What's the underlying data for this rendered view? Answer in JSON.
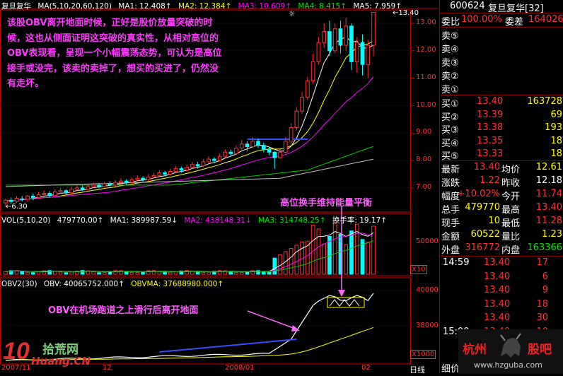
{
  "chart_header": {
    "stock_name": "复旦复华",
    "ma_label": "MA(5,10,20,60,120)",
    "ma1": "MA1: 12.408↑",
    "ma2": "MA2: 12.384↑",
    "ma3": "MA3: 10.609↑",
    "ma4": "MA4: 8.415↑",
    "ma5": "MA5: 7.959↑"
  },
  "price_axis": [
    "13.00",
    "12.00",
    "11.00",
    "10.00",
    "9.00",
    "8.00",
    "7.00"
  ],
  "price_marks": {
    "high": "13.40",
    "low": "6.30"
  },
  "vol_header": {
    "label": "VOL(5,10,20)",
    "value": "479770.00↑",
    "ma1": "MA1: 389987.59↓",
    "ma2": "MA2: 438148.31↓",
    "ma3": "MA3: 314748.25↑",
    "turnover": "换手率: 19.17↑"
  },
  "vol_axis": {
    "top": "50000",
    "unit": "X10"
  },
  "obv_header": {
    "label": "OBV2(30)",
    "obv": "OBV: 40065752.000↑",
    "obvma": "OBVMA: 37688980.000↑"
  },
  "obv_axis": {
    "top": "40000",
    "mid": "38000",
    "unit": "X1000"
  },
  "x_axis": {
    "left": "2007/11",
    "mid1": "12",
    "mid2": "2008/01",
    "right": "02",
    "daily": "日线"
  },
  "annotations": {
    "main": "该股OBV离开地面时候，正好是股价放量突破的时候，这也从侧面证明这突破的真实性，从相对高位的OBV表现看，呈现一个小幅震荡态势，可认为是高位接手或没完，该卖的卖掉了，想买的买进了，仍然没有走坏。",
    "energy": "高位换手维持能量平衡",
    "runway": "OBV在机场跑道之上滑行后离开地面"
  },
  "watermark": {
    "text1": "拾荒网",
    "text2": "Huang.CN",
    "num": "10"
  },
  "panel": {
    "code": "600624",
    "name": "复旦复华[32]",
    "weibi_label": "委比",
    "weibi": "100.00%",
    "weicha_label": "委差",
    "weicha": "164026",
    "sell_labels": [
      "卖⑤",
      "卖④",
      "卖③",
      "卖②",
      "卖①"
    ],
    "buys": [
      {
        "label": "买①",
        "price": "13.40",
        "vol": "163728"
      },
      {
        "label": "买②",
        "price": "13.39",
        "vol": "69"
      },
      {
        "label": "买③",
        "price": "13.38",
        "vol": "193"
      },
      {
        "label": "买④",
        "price": "13.35",
        "vol": "18"
      },
      {
        "label": "买⑤",
        "price": "13.33",
        "vol": "18"
      }
    ],
    "stats": [
      {
        "l1": "最新",
        "v1": "13.40",
        "l2": "均价",
        "v2": "12.61"
      },
      {
        "l1": "涨跌",
        "v1": "1.22",
        "l2": "昨收",
        "v2": "12.18"
      },
      {
        "l1": "幅度",
        "v1": "+10.02%",
        "l2": "今开",
        "v2": "11.74"
      },
      {
        "l1": "总手",
        "v1": "479770",
        "l2": "最高",
        "v2": "13.40"
      },
      {
        "l1": "现手",
        "v1": "10",
        "l2": "最低",
        "v2": "11.28"
      },
      {
        "l1": "金额",
        "v1": "60522",
        "l2": "量比",
        "v2": "1.23"
      },
      {
        "l1": "外盘",
        "v1": "316772",
        "l2": "内盘",
        "v2": "163366"
      }
    ],
    "ticks": [
      {
        "time": "14:59",
        "price": "13.40",
        "vol": "17"
      },
      {
        "time": "",
        "price": "13.40",
        "vol": "6"
      },
      {
        "time": "",
        "price": "13.40",
        "vol": "9"
      },
      {
        "time": "",
        "price": "13.40",
        "vol": "18"
      },
      {
        "time": "",
        "price": "13.40",
        "vol": "30"
      },
      {
        "time": "15:00",
        "price": "13.40",
        "vol": "10"
      }
    ],
    "footer": "细价",
    "logo_text1": "杭州",
    "logo_text2": "股吧",
    "logo_url": "www.hzguba.com"
  },
  "chart_data": {
    "type": "line",
    "price_range": [
      6.1,
      13.6
    ],
    "candles": [
      [
        6.45,
        6.55,
        6.3,
        6.6
      ],
      [
        6.55,
        6.5,
        6.4,
        6.65
      ],
      [
        6.5,
        6.62,
        6.45,
        6.7
      ],
      [
        6.6,
        6.58,
        6.5,
        6.7
      ],
      [
        6.58,
        6.7,
        6.5,
        6.75
      ],
      [
        6.7,
        6.65,
        6.55,
        6.8
      ],
      [
        6.65,
        6.75,
        6.6,
        6.85
      ],
      [
        6.75,
        6.8,
        6.7,
        6.9
      ],
      [
        6.8,
        6.72,
        6.65,
        6.88
      ],
      [
        6.72,
        6.85,
        6.7,
        6.95
      ],
      [
        6.85,
        6.9,
        6.8,
        7.0
      ],
      [
        6.9,
        6.82,
        6.75,
        6.95
      ],
      [
        6.82,
        6.95,
        6.78,
        7.05
      ],
      [
        6.95,
        7.0,
        6.9,
        7.1
      ],
      [
        7.0,
        6.95,
        6.88,
        7.08
      ],
      [
        6.95,
        7.05,
        6.9,
        7.12
      ],
      [
        7.05,
        7.1,
        7.0,
        7.2
      ],
      [
        7.1,
        7.05,
        6.98,
        7.18
      ],
      [
        7.05,
        7.15,
        7.0,
        7.22
      ],
      [
        7.15,
        7.1,
        7.05,
        7.25
      ],
      [
        7.1,
        7.2,
        7.05,
        7.28
      ],
      [
        7.2,
        7.25,
        7.15,
        7.35
      ],
      [
        7.25,
        7.2,
        7.1,
        7.32
      ],
      [
        7.2,
        7.3,
        7.15,
        7.38
      ],
      [
        7.3,
        7.35,
        7.25,
        7.45
      ],
      [
        7.35,
        7.3,
        7.22,
        7.42
      ],
      [
        7.3,
        7.4,
        7.25,
        7.5
      ],
      [
        7.4,
        7.45,
        7.35,
        7.55
      ],
      [
        7.45,
        7.55,
        7.4,
        7.65
      ],
      [
        7.55,
        7.5,
        7.42,
        7.62
      ],
      [
        7.5,
        7.6,
        7.45,
        7.7
      ],
      [
        7.6,
        7.7,
        7.55,
        7.8
      ],
      [
        7.7,
        7.65,
        7.55,
        7.78
      ],
      [
        7.65,
        7.75,
        7.6,
        7.85
      ],
      [
        7.75,
        7.85,
        7.7,
        7.95
      ],
      [
        7.85,
        7.8,
        7.7,
        7.95
      ],
      [
        7.8,
        7.95,
        7.75,
        8.05
      ],
      [
        7.95,
        8.05,
        7.9,
        8.15
      ],
      [
        8.05,
        8.0,
        7.9,
        8.12
      ],
      [
        8.0,
        8.15,
        7.95,
        8.25
      ],
      [
        8.15,
        8.3,
        8.1,
        8.4
      ],
      [
        8.3,
        8.25,
        8.15,
        8.4
      ],
      [
        8.25,
        8.45,
        8.2,
        8.55
      ],
      [
        8.45,
        8.6,
        8.4,
        8.75
      ],
      [
        8.6,
        8.5,
        8.35,
        8.7
      ],
      [
        8.5,
        8.7,
        8.45,
        8.85
      ],
      [
        8.7,
        8.55,
        8.45,
        8.8
      ],
      [
        8.55,
        8.4,
        8.3,
        8.65
      ],
      [
        8.4,
        8.3,
        8.2,
        8.5
      ],
      [
        8.3,
        8.1,
        7.7,
        8.35
      ],
      [
        8.1,
        8.3,
        8.05,
        8.4
      ],
      [
        8.3,
        8.7,
        8.25,
        8.85
      ],
      [
        8.7,
        9.2,
        8.6,
        9.35
      ],
      [
        9.2,
        9.8,
        9.1,
        9.95
      ],
      [
        9.8,
        10.3,
        9.7,
        10.5
      ],
      [
        10.3,
        10.9,
        10.2,
        11.05
      ],
      [
        10.9,
        11.6,
        10.8,
        11.9
      ],
      [
        11.6,
        12.3,
        11.5,
        12.5
      ],
      [
        12.3,
        12.7,
        12.1,
        13.0
      ],
      [
        12.7,
        12.0,
        11.8,
        13.1
      ],
      [
        12.0,
        12.8,
        11.9,
        13.0
      ],
      [
        12.8,
        12.2,
        11.9,
        13.1
      ],
      [
        12.2,
        12.9,
        12.0,
        13.2
      ],
      [
        12.9,
        11.6,
        11.3,
        13.0
      ],
      [
        11.6,
        12.3,
        11.2,
        12.5
      ],
      [
        12.3,
        11.5,
        11.1,
        12.6
      ],
      [
        11.5,
        12.2,
        11.0,
        12.4
      ],
      [
        12.2,
        13.4,
        11.8,
        13.4
      ]
    ]
  }
}
